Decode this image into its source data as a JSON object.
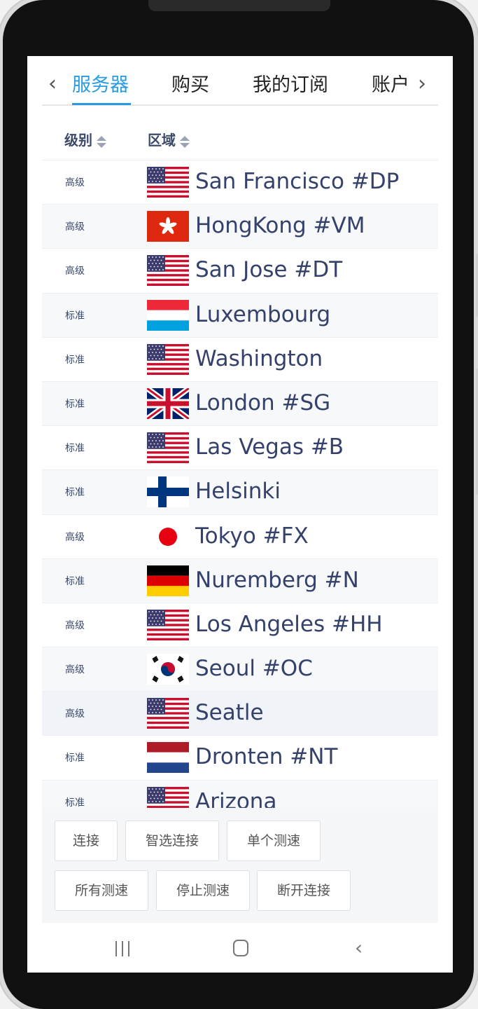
{
  "tabs": {
    "prev_arrow": "‹",
    "next_arrow": "›",
    "items": [
      {
        "label": "服务器",
        "active": true
      },
      {
        "label": "购买",
        "active": false
      },
      {
        "label": "我的订阅",
        "active": false
      },
      {
        "label": "账户",
        "active": false
      }
    ]
  },
  "table": {
    "headers": [
      {
        "label": "级别",
        "sort_icon": "sort-icon"
      },
      {
        "label": "区域",
        "sort_icon": "sort-icon"
      }
    ],
    "rows": [
      {
        "level": "高级",
        "flag": "us-flag",
        "region": "San Francisco #DP"
      },
      {
        "level": "高级",
        "flag": "hk-flag",
        "region": "HongKong #VM"
      },
      {
        "level": "高级",
        "flag": "us-flag",
        "region": "San Jose #DT"
      },
      {
        "level": "标准",
        "flag": "lu-flag",
        "region": "Luxembourg"
      },
      {
        "level": "标准",
        "flag": "us-flag",
        "region": "Washington"
      },
      {
        "level": "标准",
        "flag": "gb-flag",
        "region": "London #SG"
      },
      {
        "level": "标准",
        "flag": "us-flag",
        "region": "Las Vegas #B"
      },
      {
        "level": "标准",
        "flag": "fi-flag",
        "region": "Helsinki"
      },
      {
        "level": "高级",
        "flag": "jp-flag",
        "region": "Tokyo #FX"
      },
      {
        "level": "标准",
        "flag": "de-flag",
        "region": "Nuremberg #N"
      },
      {
        "level": "高级",
        "flag": "us-flag",
        "region": "Los Angeles #HH"
      },
      {
        "level": "高级",
        "flag": "kr-flag",
        "region": "Seoul #OC"
      },
      {
        "level": "高级",
        "flag": "us-flag",
        "region": "Seatle"
      },
      {
        "level": "标准",
        "flag": "nl-flag",
        "region": "Dronten #NT"
      },
      {
        "level": "标准",
        "flag": "us-flag",
        "region": "Arizona"
      }
    ]
  },
  "buttons": {
    "connect": "连接",
    "smart_connect": "智选连接",
    "single_speedtest": "单个测速",
    "all_speedtest": "所有测速",
    "stop_speedtest": "停止测速",
    "disconnect": "断开连接"
  },
  "colors": {
    "accent": "#2a9be0",
    "text_primary": "#34416b",
    "header_text": "#3b4a6b"
  }
}
